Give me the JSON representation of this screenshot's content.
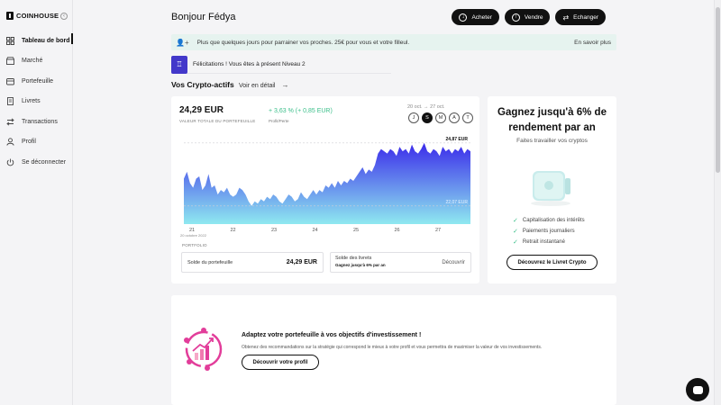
{
  "brand": {
    "name": "COINHOUSE"
  },
  "sidebar": {
    "items": [
      {
        "label": "Tableau de bord",
        "icon": "dashboard-icon",
        "active": true
      },
      {
        "label": "Marché",
        "icon": "market-icon"
      },
      {
        "label": "Portefeuille",
        "icon": "wallet-icon"
      },
      {
        "label": "Livrets",
        "icon": "booklet-icon"
      },
      {
        "label": "Transactions",
        "icon": "transactions-icon"
      },
      {
        "label": "Profil",
        "icon": "user-icon"
      },
      {
        "label": "Se déconnecter",
        "icon": "logout-icon"
      }
    ]
  },
  "header": {
    "greeting": "Bonjour Fédya",
    "buttons": {
      "buy": "Acheter",
      "sell": "Vendre",
      "exchange": "Echanger"
    }
  },
  "referral_banner": {
    "text": "Plus que quelques jours pour parrainer vos proches. 25€ pour vous et votre filleul.",
    "link": "En savoir plus"
  },
  "level_notice": {
    "text": "Félicitations ! Vous êtes à présent Niveau 2"
  },
  "crypto_section": {
    "title": "Vos Crypto-actifs",
    "detail_link": "Voir en détail",
    "balance": "24,29 EUR",
    "balance_label": "VALEUR TOTALE DU PORTEFEUILLE",
    "performance": "+ 3,63 % (+ 0,85 EUR)",
    "performance_label": "Profit/Perte",
    "date_range": "20 oct. → 27 oct.",
    "periods": [
      {
        "label": "J"
      },
      {
        "label": "S",
        "active": true
      },
      {
        "label": "M"
      },
      {
        "label": "A"
      },
      {
        "label": "T"
      }
    ],
    "portfolio_label": "PORTFOLIO",
    "portfolio_balance_label": "Solde du portefeuille",
    "portfolio_balance_value": "24,29 EUR",
    "livrets_label": "Solde des livrets",
    "livrets_promo": "Gagnez jusqu'à 6% par an",
    "livrets_link": "Découvrir"
  },
  "chart_data": {
    "type": "area",
    "x_ticks": [
      "21",
      "22",
      "23",
      "24",
      "25",
      "26",
      "27"
    ],
    "x_sublabel": "20 octobre 2022",
    "max_label": "24,87 EUR",
    "min_label": "22,07 EUR",
    "ylim": [
      21.3,
      25.1
    ],
    "series": [
      {
        "values": [
          23.3,
          23.6,
          23.1,
          22.9,
          23.3,
          23.4,
          22.8,
          23.0,
          23.5,
          22.9,
          23.0,
          22.6,
          22.8,
          22.7,
          22.9,
          22.6,
          22.5,
          22.6,
          22.9,
          22.8,
          22.6,
          22.3,
          22.1,
          22.3,
          22.2,
          22.4,
          22.3,
          22.5,
          22.4,
          22.6,
          22.5,
          22.3,
          22.2,
          22.4,
          22.6,
          22.5,
          22.3,
          22.4,
          22.7,
          22.5,
          22.4,
          22.6,
          22.8,
          22.6,
          22.8,
          22.7,
          23.0,
          22.9,
          23.1,
          22.9,
          23.2,
          23.0,
          23.2,
          23.1,
          23.3,
          23.2,
          23.4,
          23.6,
          23.8,
          23.5,
          23.7,
          23.6,
          23.9,
          24.4,
          24.6,
          24.5,
          24.4,
          24.6,
          24.5,
          24.3,
          24.7,
          24.5,
          24.6,
          24.4,
          24.8,
          24.5,
          24.4,
          24.6,
          24.87,
          24.5,
          24.4,
          24.6,
          24.5,
          24.3,
          24.7,
          24.5,
          24.6,
          24.4,
          24.6,
          24.5,
          24.7,
          24.4,
          24.6,
          24.5
        ]
      }
    ]
  },
  "promo": {
    "title": "Gagnez jusqu'à 6% de rendement par an",
    "subtitle": "Faites travailler vos cryptos",
    "features": [
      "Capitalisation des intérêts",
      "Paiements journaliers",
      "Retrait instantané"
    ],
    "button": "Découvrez le Livret Crypto"
  },
  "profile_card": {
    "title": "Adaptez votre portefeuille à vos objectifs d'investissement !",
    "description": "Obtenez des recommandations sur la stratégie qui correspond le mieux à votre profil et vous permettra de maximiser la valeur de vos investissements.",
    "button": "Découvrir votre profil"
  },
  "colors": {
    "accent": "#4338ca",
    "positive": "#3bbf8a",
    "banner_bg": "#e6f3ef",
    "chart_top": "#3b2bea",
    "chart_bottom": "#8fe9f0"
  }
}
